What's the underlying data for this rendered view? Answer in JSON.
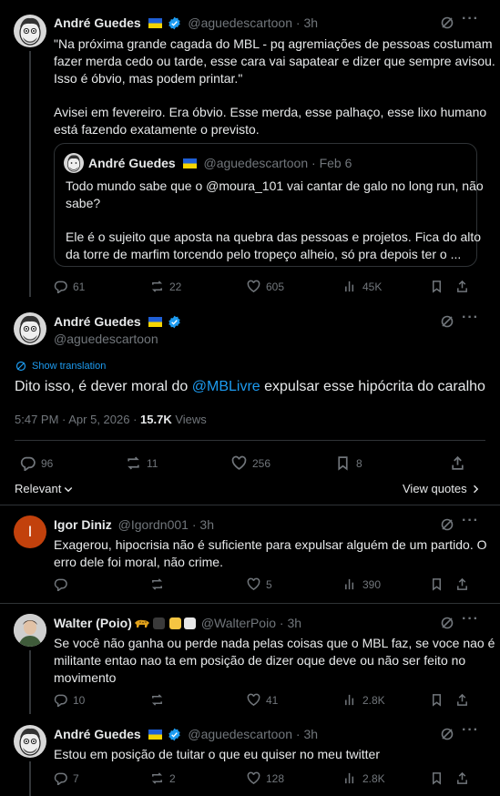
{
  "flag_colors": {
    "top": "#1f5fd6",
    "bottom": "#f5d400"
  },
  "verified_color": "#1d9bf0",
  "parent_tweet": {
    "name": "André Guedes",
    "handle": "@aguedescartoon",
    "time": "3h",
    "text_line1": "\"Na próxima grande cagada do MBL - pq agremiações de pessoas costumam",
    "text_line2": "fazer merda cedo ou tarde, esse cara vai sapatear e dizer que sempre avisou.",
    "text_line3": "Isso é óbvio, mas podem printar.\"",
    "text_line4": "Avisei em fevereiro. Era óbvio. Esse merda, esse palhaço, esse lixo humano",
    "text_line5": "está fazendo exatamente o previsto.",
    "quote": {
      "name": "André Guedes",
      "handle": "@aguedescartoon",
      "date": "Feb 6",
      "line1": "Todo mundo sabe que o @moura_101 vai cantar de galo no long run, não",
      "line2": "sabe?",
      "line3": "Ele é o sujeito que aposta na quebra das pessoas e projetos. Fica do alto",
      "line4": "da torre de marfim torcendo pelo tropeço alheio, só pra depois ter o ..."
    },
    "replies": "61",
    "reposts": "22",
    "likes": "605",
    "views": "45K"
  },
  "main_tweet": {
    "name": "André Guedes",
    "handle": "@aguedescartoon",
    "show_translation": "Show translation",
    "text_before": "Dito isso, é dever moral do ",
    "mention": "@MBLivre",
    "text_after": "  expulsar esse hipócrita do caralho",
    "timestamp": "5:47 PM · Apr 5, 2026 · ",
    "views_count": "15.7K",
    "views_label": " Views",
    "replies": "96",
    "reposts": "11",
    "likes": "256",
    "bookmarks": "8",
    "relevant": "Relevant",
    "view_quotes": "View quotes"
  },
  "reply1": {
    "initial": "I",
    "avatar_color": "#c2410c",
    "name": "Igor Diniz",
    "handle": "@Igordn001",
    "time": "3h",
    "line1": "Exagerou, hipocrisia não é suficiente para expulsar alguém de um partido. O",
    "line2": "erro dele foi moral, não crime.",
    "replies": "",
    "reposts": "",
    "likes": "5",
    "views": "390"
  },
  "reply2": {
    "name": "Walter (Poio)",
    "handle": "@WalterPoio",
    "time": "3h",
    "line1": "Se você não ganha ou perde nada pelas coisas que o MBL faz, se voce nao é",
    "line2": "militante entao nao ta em posição de dizer oque deve ou não ser feito no",
    "line3": "movimento",
    "replies": "10",
    "reposts": "",
    "likes": "41",
    "views": "2.8K"
  },
  "reply3": {
    "name": "André Guedes",
    "handle": "@aguedescartoon",
    "time": "3h",
    "line1": "Estou em posição de tuitar o que eu quiser no meu twitter",
    "replies": "7",
    "reposts": "2",
    "likes": "128",
    "views": "2.8K"
  }
}
